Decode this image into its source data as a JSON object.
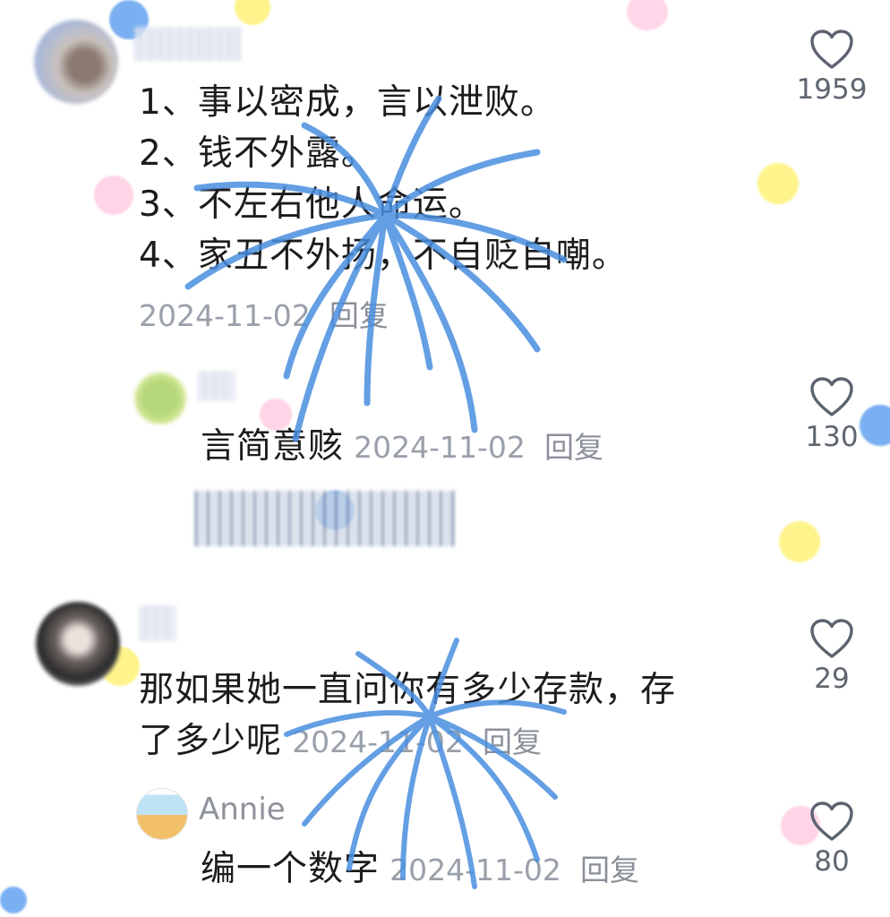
{
  "comments": [
    {
      "lines": [
        "1、事以密成，言以泄败。",
        "2、钱不外露。",
        "3、不左右他人命运。",
        "4、家丑不外扬，不自贬自嘲。"
      ],
      "date": "2024-11-02",
      "reply_label": "回复",
      "likes": "1959"
    },
    {
      "text": "言简意赅",
      "date": "2024-11-02",
      "reply_label": "回复",
      "likes": "130"
    },
    {
      "lines": [
        "那如果她一直问你有多少存款，存",
        "了多少呢"
      ],
      "date": "2024-11-02",
      "reply_label": "回复",
      "likes": "29"
    },
    {
      "author": "Annie",
      "text": "编一个数字",
      "date": "2024-11-02",
      "reply_label": "回复",
      "likes": "80"
    }
  ],
  "icons": {
    "like": "heart-outline-icon"
  },
  "colors": {
    "firework": "#4a8fe0",
    "dot_pink": "#ffd4e6",
    "dot_yellow": "#fff59a",
    "dot_blue": "#6aa6ef"
  }
}
